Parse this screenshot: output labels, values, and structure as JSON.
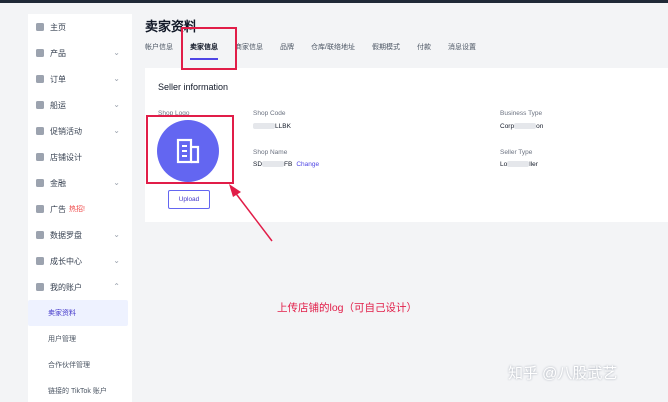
{
  "sidebar": {
    "items": [
      {
        "label": "主页",
        "icon": "home-icon",
        "chevron": ""
      },
      {
        "label": "产品",
        "icon": "box-icon",
        "chevron": "⌄"
      },
      {
        "label": "订单",
        "icon": "list-icon",
        "chevron": "⌄"
      },
      {
        "label": "船运",
        "icon": "truck-icon",
        "chevron": "⌄"
      },
      {
        "label": "促销活动",
        "icon": "megaphone-icon",
        "chevron": "⌄"
      },
      {
        "label": "店铺设计",
        "icon": "store-icon",
        "chevron": ""
      },
      {
        "label": "金融",
        "icon": "wallet-icon",
        "chevron": "⌄"
      },
      {
        "label": "广告",
        "hot": "热招!",
        "icon": "ad-icon",
        "chevron": ""
      },
      {
        "label": "数据罗盘",
        "icon": "chart-icon",
        "chevron": "⌄"
      },
      {
        "label": "成长中心",
        "icon": "medal-icon",
        "chevron": "⌄"
      },
      {
        "label": "我的账户",
        "icon": "user-icon",
        "chevron": "⌃"
      }
    ],
    "sub_items": [
      {
        "label": "卖家资料",
        "active": true
      },
      {
        "label": "用户管理",
        "active": false
      },
      {
        "label": "合作伙伴管理",
        "active": false
      },
      {
        "label": "链接的 TikTok 账户",
        "active": false
      }
    ]
  },
  "page": {
    "title": "卖家资料",
    "tabs": [
      "帐户信息",
      "卖家信息",
      "商家信息",
      "品牌",
      "仓库/联络地址",
      "假期模式",
      "付款",
      "消息设置"
    ],
    "active_tab": 1
  },
  "card": {
    "title": "Seller information",
    "shop_logo_label": "Shop Logo",
    "upload_label": "Upload",
    "shop_code_label": "Shop Code",
    "shop_code_value": "LLBK",
    "shop_name_label": "Shop Name",
    "shop_name_prefix": "SD",
    "shop_name_value": "FB",
    "change_label": "Change",
    "business_type_label": "Business Type",
    "business_type_prefix": "Corp",
    "business_type_value": "on",
    "seller_type_label": "Seller Type",
    "seller_type_prefix": "Lo",
    "seller_type_value": "ller"
  },
  "annotation": "上传店铺的log（可自己设计）",
  "watermark": "知乎 @八股武艺",
  "colors": {
    "accent": "#4f46e5",
    "annotation": "#e11d48"
  }
}
